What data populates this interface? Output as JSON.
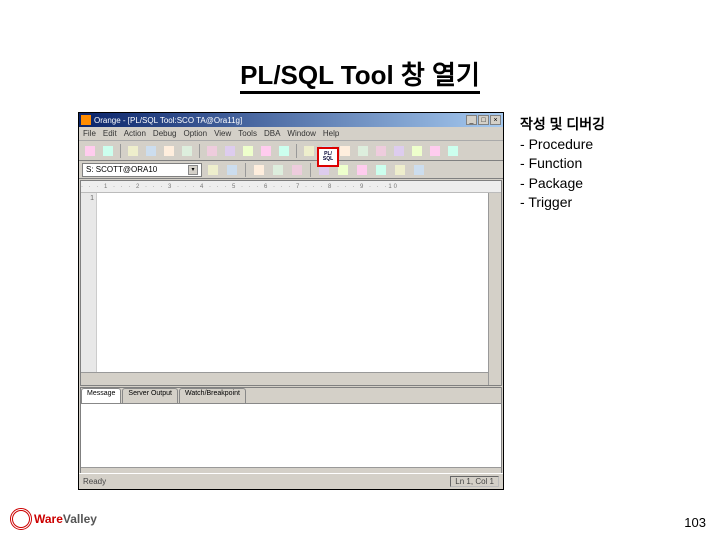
{
  "slide": {
    "title": "PL/SQL Tool 창 열기",
    "page_number": "103"
  },
  "screenshot": {
    "window_title": "Orange - [PL/SQL Tool:SCO TA@Ora11g]",
    "menus": [
      "File",
      "Edit",
      "Action",
      "Debug",
      "Option",
      "View",
      "Tools",
      "DBA",
      "Window",
      "Help"
    ],
    "plsql_button": {
      "line1": "PL/",
      "line2": "SQL"
    },
    "schema_dropdown": "S: SCOTT@ORA10",
    "editor": {
      "first_line_number": "1"
    },
    "bottom_tabs": [
      "Message",
      "Server Output",
      "Watch/Breakpoint"
    ],
    "status_left": "Ready",
    "status_right": "Ln 1, Col 1"
  },
  "sidebar": {
    "heading": "작성 및 디버깅",
    "items": [
      "Procedure",
      "Function",
      "Package",
      "Trigger"
    ]
  },
  "logo": {
    "brand1": "Ware",
    "brand2": "Valley"
  }
}
